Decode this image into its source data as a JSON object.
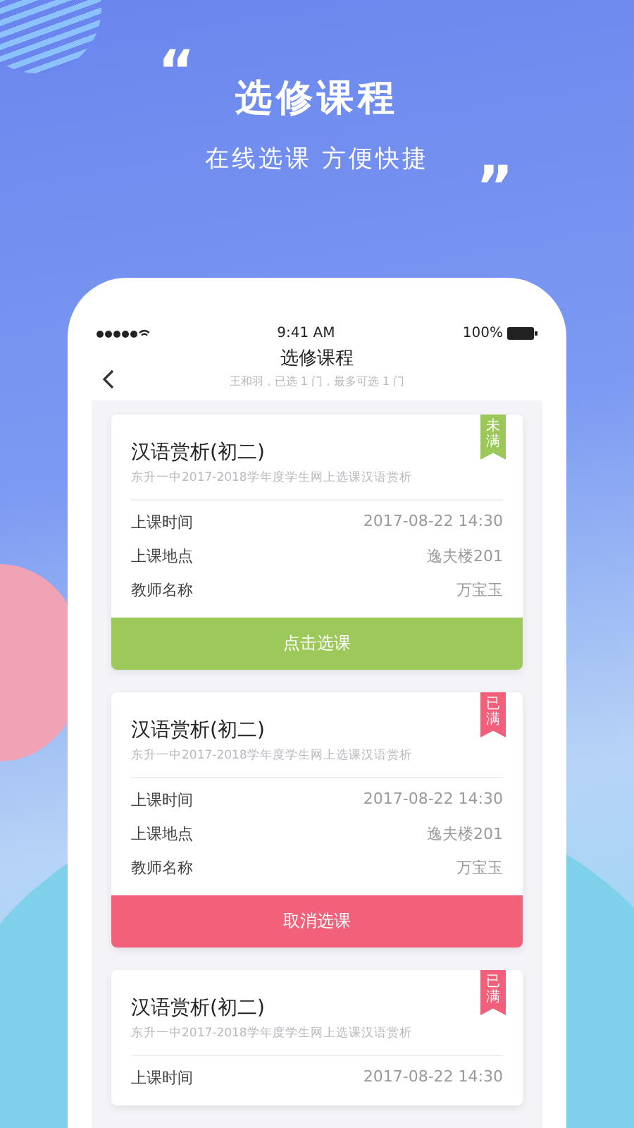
{
  "hero": {
    "quote_open": "“",
    "title": "选修课程",
    "subtitle": "在线选课 方便快捷",
    "quote_close": "”"
  },
  "status_bar": {
    "time": "9:41 AM",
    "battery": "100%"
  },
  "nav": {
    "title": "选修课程",
    "subtitle": "王和羽，已选 1 门，最多可选 1 门"
  },
  "courses": [
    {
      "name": "汉语赏析(初二)",
      "description": "东升一中2017-2018学年度学生网上选课汉语赏析",
      "badge": "未满",
      "full": false,
      "rows": [
        {
          "label": "上课时间",
          "value": "2017-08-22 14:30"
        },
        {
          "label": "上课地点",
          "value": "逸夫楼201"
        },
        {
          "label": "教师名称",
          "value": "万宝玉"
        }
      ],
      "action": "点击选课"
    },
    {
      "name": "汉语赏析(初二)",
      "description": "东升一中2017-2018学年度学生网上选课汉语赏析",
      "badge": "已满",
      "full": true,
      "rows": [
        {
          "label": "上课时间",
          "value": "2017-08-22 14:30"
        },
        {
          "label": "上课地点",
          "value": "逸夫楼201"
        },
        {
          "label": "教师名称",
          "value": "万宝玉"
        }
      ],
      "action": "取消选课"
    },
    {
      "name": "汉语赏析(初二)",
      "description": "东升一中2017-2018学年度学生网上选课汉语赏析",
      "badge": "已满",
      "full": true,
      "rows": [
        {
          "label": "上课时间",
          "value": "2017-08-22 14:30"
        }
      ]
    }
  ]
}
